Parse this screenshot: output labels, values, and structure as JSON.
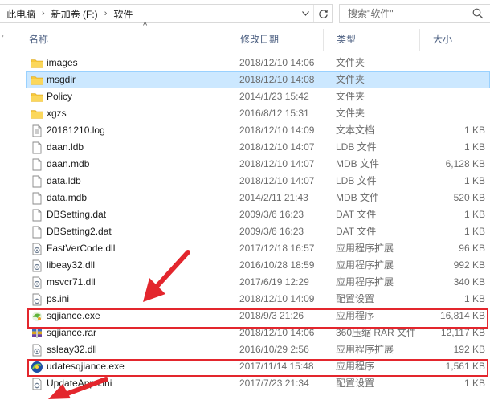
{
  "breadcrumb": {
    "items": [
      "此电脑",
      "新加卷 (F:)",
      "软件"
    ]
  },
  "search": {
    "placeholder": "搜索\"软件\""
  },
  "columns": {
    "name": "名称",
    "date": "修改日期",
    "type": "类型",
    "size": "大小"
  },
  "files": [
    {
      "name": "images",
      "date": "2018/12/10 14:06",
      "type": "文件夹",
      "size": "",
      "icon": "folder-icon"
    },
    {
      "name": "msgdir",
      "date": "2018/12/10 14:08",
      "type": "文件夹",
      "size": "",
      "icon": "folder-icon"
    },
    {
      "name": "Policy",
      "date": "2014/1/23 15:42",
      "type": "文件夹",
      "size": "",
      "icon": "folder-icon"
    },
    {
      "name": "xgzs",
      "date": "2016/8/12 15:31",
      "type": "文件夹",
      "size": "",
      "icon": "folder-icon"
    },
    {
      "name": "20181210.log",
      "date": "2018/12/10 14:09",
      "type": "文本文档",
      "size": "1 KB",
      "icon": "text-file-icon"
    },
    {
      "name": "daan.ldb",
      "date": "2018/12/10 14:07",
      "type": "LDB 文件",
      "size": "1 KB",
      "icon": "file-icon"
    },
    {
      "name": "daan.mdb",
      "date": "2018/12/10 14:07",
      "type": "MDB 文件",
      "size": "6,128 KB",
      "icon": "file-icon"
    },
    {
      "name": "data.ldb",
      "date": "2018/12/10 14:07",
      "type": "LDB 文件",
      "size": "1 KB",
      "icon": "file-icon"
    },
    {
      "name": "data.mdb",
      "date": "2014/2/11 21:43",
      "type": "MDB 文件",
      "size": "520 KB",
      "icon": "file-icon"
    },
    {
      "name": "DBSetting.dat",
      "date": "2009/3/6 16:23",
      "type": "DAT 文件",
      "size": "1 KB",
      "icon": "file-icon"
    },
    {
      "name": "DBSetting2.dat",
      "date": "2009/3/6 16:23",
      "type": "DAT 文件",
      "size": "1 KB",
      "icon": "file-icon"
    },
    {
      "name": "FastVerCode.dll",
      "date": "2017/12/18 16:57",
      "type": "应用程序扩展",
      "size": "96 KB",
      "icon": "dll-icon"
    },
    {
      "name": "libeay32.dll",
      "date": "2016/10/28 18:59",
      "type": "应用程序扩展",
      "size": "992 KB",
      "icon": "dll-icon"
    },
    {
      "name": "msvcr71.dll",
      "date": "2017/6/19 12:29",
      "type": "应用程序扩展",
      "size": "340 KB",
      "icon": "dll-icon"
    },
    {
      "name": "ps.ini",
      "date": "2018/12/10 14:09",
      "type": "配置设置",
      "size": "1 KB",
      "icon": "ini-icon"
    },
    {
      "name": "sqjiance.exe",
      "date": "2018/9/3 21:26",
      "type": "应用程序",
      "size": "16,814 KB",
      "icon": "app-icon"
    },
    {
      "name": "sqjiance.rar",
      "date": "2018/12/10 14:06",
      "type": "360压缩 RAR 文件",
      "size": "12,117 KB",
      "icon": "archive-icon"
    },
    {
      "name": "ssleay32.dll",
      "date": "2016/10/29 2:56",
      "type": "应用程序扩展",
      "size": "192 KB",
      "icon": "dll-icon"
    },
    {
      "name": "udatesqjiance.exe",
      "date": "2017/11/14 15:48",
      "type": "应用程序",
      "size": "1,561 KB",
      "icon": "update-app-icon"
    },
    {
      "name": "UpdateApps.ini",
      "date": "2017/7/23 21:34",
      "type": "配置设置",
      "size": "1 KB",
      "icon": "ini-icon"
    }
  ],
  "colors": {
    "selection_bg": "#cce8ff",
    "selection_border": "#99d1ff",
    "highlight_red": "#e3262d",
    "folder_yellow": "#f8c93a",
    "header_text": "#4d6082"
  }
}
